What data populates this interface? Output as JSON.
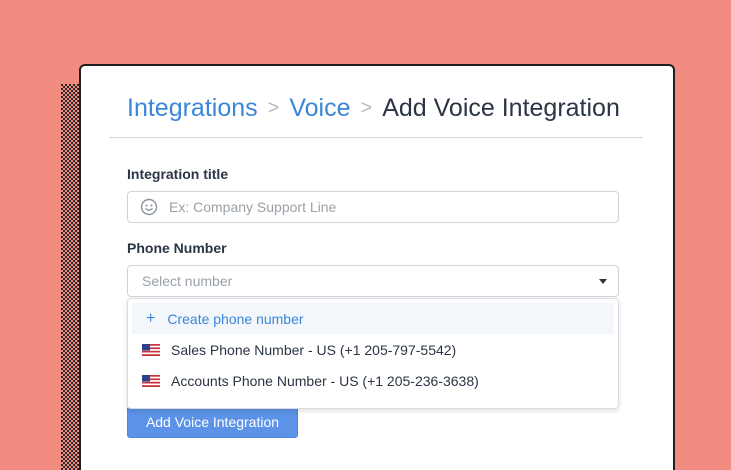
{
  "breadcrumb": {
    "items": [
      "Integrations",
      "Voice"
    ],
    "separator": ">",
    "current": "Add Voice Integration"
  },
  "form": {
    "title_label": "Integration title",
    "title_placeholder": "Ex: Company Support Line",
    "phone_label": "Phone Number",
    "phone_placeholder": "Select number",
    "submit_label": "Add Voice Integration"
  },
  "dropdown": {
    "create_label": "Create phone number",
    "options": [
      {
        "label": "Sales Phone Number - US (+1 205-797-5542)",
        "flag": "us-flag-icon"
      },
      {
        "label": "Accounts Phone Number - US (+1 205-236-3638)",
        "flag": "us-flag-icon"
      }
    ]
  },
  "colors": {
    "background": "#f28b80",
    "accent": "#3a86d8",
    "button": "#5c93e8"
  }
}
